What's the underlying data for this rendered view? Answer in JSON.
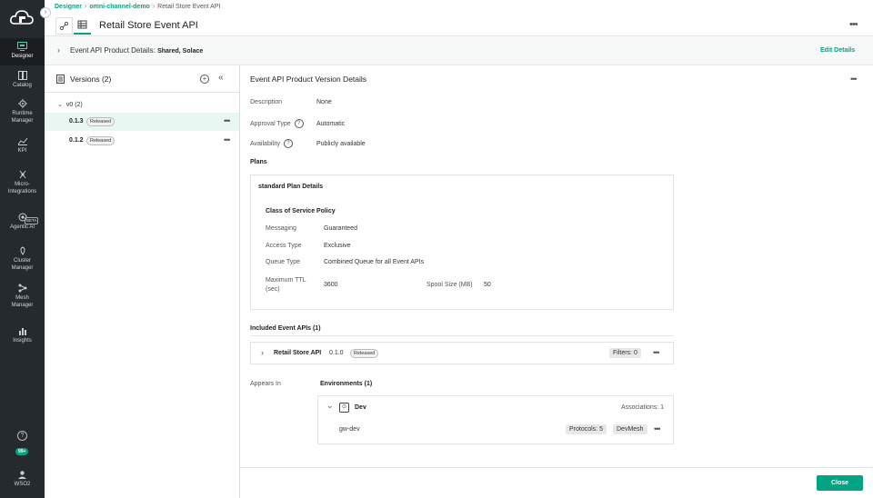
{
  "nav": {
    "items": [
      {
        "label": "Designer",
        "icon": "designer-icon"
      },
      {
        "label": "Catalog",
        "icon": "catalog-icon"
      },
      {
        "label": "Runtime Manager",
        "icon": "runtime-icon"
      },
      {
        "label": "KPI",
        "icon": "kpi-icon"
      },
      {
        "label": "Micro-Integrations",
        "icon": "micro-integrations-icon"
      },
      {
        "label": "Agentic AI",
        "icon": "agentic-ai-icon",
        "badge": "BETA"
      },
      {
        "label": "Cluster Manager",
        "icon": "cluster-icon"
      },
      {
        "label": "Mesh Manager",
        "icon": "mesh-icon"
      },
      {
        "label": "Insights",
        "icon": "insights-icon"
      }
    ],
    "help_icon": "help-icon",
    "notification_count": "99+",
    "user": "WSO2"
  },
  "breadcrumb": {
    "root": "Designer",
    "app": "omni-channel-demo",
    "current": "Retail Store Event API"
  },
  "header": {
    "title": "Retail Store Event API"
  },
  "summary": {
    "label": "Event API Product Details:",
    "value": "Shared, Solace",
    "edit_label": "Edit Details"
  },
  "versions": {
    "title": "Versions (2)",
    "group": "v0 (2)",
    "items": [
      {
        "version": "0.1.3",
        "status": "Released",
        "selected": true
      },
      {
        "version": "0.1.2",
        "status": "Released",
        "selected": false
      }
    ]
  },
  "details": {
    "title": "Event API Product Version Details",
    "description_label": "Description",
    "description_value": "None",
    "approval_label": "Approval Type",
    "approval_value": "Automatic",
    "availability_label": "Availability",
    "availability_value": "Publicly available",
    "plans_label": "Plans",
    "plan": {
      "title": "standard Plan Details",
      "cos_title": "Class of Service Policy",
      "messaging_label": "Messaging",
      "messaging_value": "Guaranteed",
      "access_label": "Access Type",
      "access_value": "Exclusive",
      "queue_label": "Queue Type",
      "queue_value": "Combined Queue for all Event APIs",
      "ttl_label_1": "Maximum TTL",
      "ttl_label_2": "(sec)",
      "ttl_value": "3600",
      "spool_label": "Spool Size (MB)",
      "spool_value": "50"
    },
    "included_label": "Included Event APIs (1)",
    "included_api": {
      "name": "Retail Store API",
      "version": "0.1.0",
      "status": "Released",
      "filters": "Filters: 0"
    },
    "appears_label": "Appears In",
    "environments_label": "Environments (1)",
    "environment": {
      "name": "Dev",
      "associations": "Associations: 1",
      "mesh_name": "gw-dev",
      "protocols": "Protocols: 5",
      "mesh": "DevMesh"
    }
  },
  "footer": {
    "close_label": "Close"
  }
}
